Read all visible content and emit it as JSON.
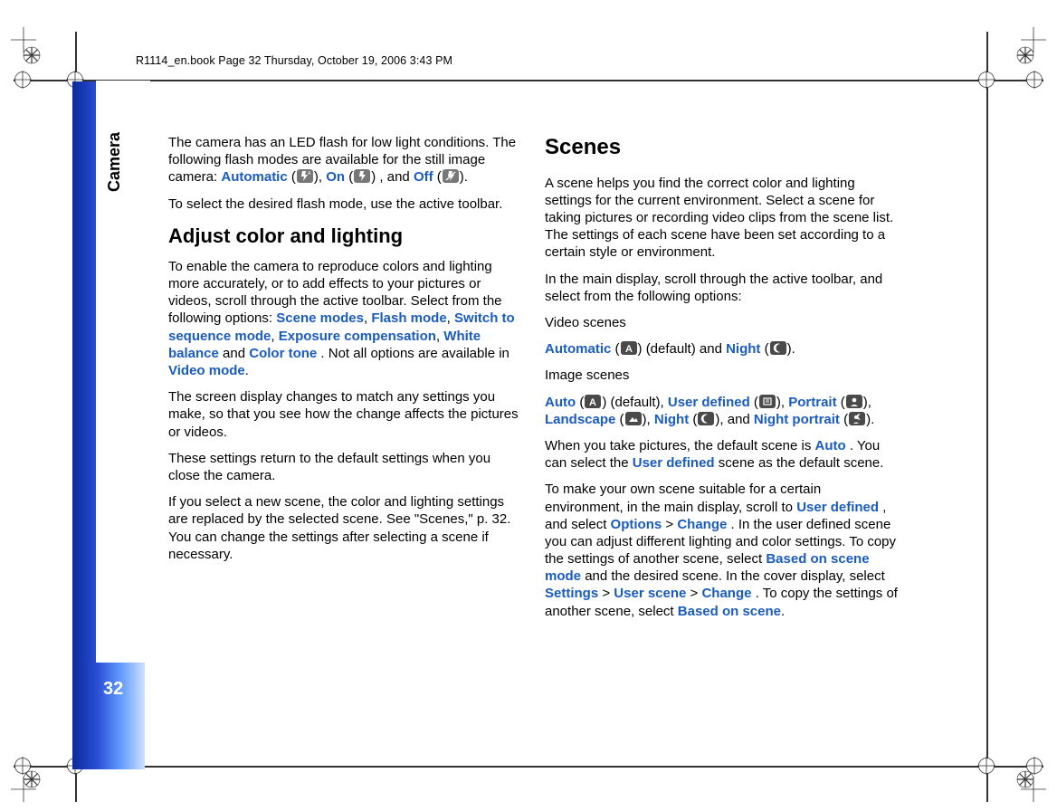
{
  "header": "R1114_en.book  Page 32  Thursday, October 19, 2006  3:43 PM",
  "section_label": "Camera",
  "page_number": "32",
  "col1": {
    "flash_intro_a": "The camera has an LED flash for low light conditions. The following flash modes are available for the still image camera: ",
    "flash_auto": "Automatic",
    "flash_on": "On",
    "flash_off": "Off",
    "flash_intro_and": ", and ",
    "flash_select": "To select the desired flash mode, use the active toolbar.",
    "h_adjust": "Adjust color and lighting",
    "adjust_p1a": "To enable the camera to reproduce colors and lighting more accurately, or to add effects to your pictures or videos, scroll through the active toolbar. Select from the following options: ",
    "opt_scene": "Scene modes",
    "opt_flash": "Flash mode",
    "opt_seq": "Switch to sequence mode",
    "opt_exp": "Exposure compensation",
    "opt_wb": "White balance",
    "opt_and": " and ",
    "opt_color": "Color tone",
    "adjust_p1b": ". Not all options are available in ",
    "opt_video": "Video mode",
    "adjust_p2": "The screen display changes to match any settings you make, so that you see how the change affects the pictures or videos.",
    "adjust_p3": "These settings return to the default settings when you close the camera.",
    "adjust_p4": "If you select a new scene, the color and lighting settings are replaced by the selected scene. See \"Scenes,\" p. 32. You can change the settings after selecting a scene if necessary."
  },
  "col2": {
    "h_scenes": "Scenes",
    "scenes_p1": "A scene helps you find the correct color and lighting settings for the current environment. Select a scene for taking pictures or recording video clips from the scene list. The settings of each scene have been set according to a certain style or environment.",
    "scenes_p2": "In the main display, scroll through the active toolbar, and select from the following options:",
    "video_scenes_lbl": "Video scenes",
    "vs_auto": "Automatic",
    "vs_default": " (default) and ",
    "vs_night": "Night",
    "image_scenes_lbl": "Image scenes",
    "is_auto": "Auto",
    "is_default": " (default), ",
    "is_user": "User defined",
    "is_portrait": "Portrait",
    "is_landscape": "Landscape",
    "is_night": "Night",
    "is_nightp": "Night portrait",
    "default_scene_a": "When you take pictures, the default scene is ",
    "default_scene_auto": "Auto",
    "default_scene_b": ". You can select the ",
    "default_scene_user": "User defined",
    "default_scene_c": " scene as the default scene.",
    "own_a": "To make your own scene suitable for a certain environment, in the main display, scroll to ",
    "own_user": "User defined",
    "own_b": ", and select ",
    "own_options": "Options",
    "own_gt": " > ",
    "own_change": "Change",
    "own_c": ". In the user defined scene you can adjust different lighting and color settings. To copy the settings of another scene, select ",
    "own_based": "Based on scene mode",
    "own_d": " and the desired scene. In the cover display, select ",
    "own_settings": "Settings",
    "own_uscene": "User scene",
    "own_e": ". To copy the settings of another scene, select ",
    "own_based2": "Based on scene"
  }
}
